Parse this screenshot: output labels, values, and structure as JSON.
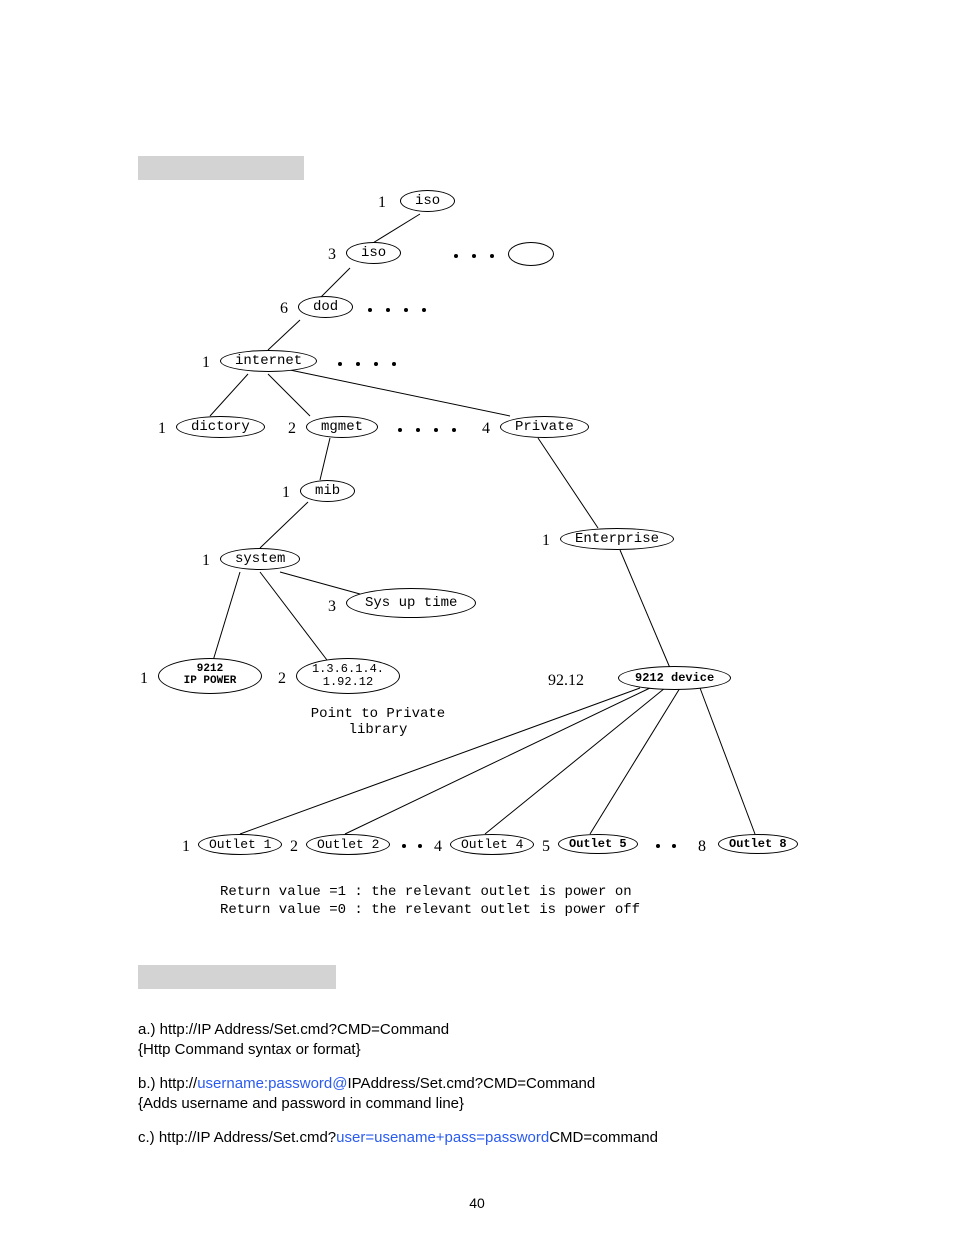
{
  "headers": {
    "section1": "",
    "section2": ""
  },
  "nodes": {
    "iso1": "iso",
    "iso2": "iso",
    "dod": "dod",
    "internet": "internet",
    "dictory": "dictory",
    "mgmet": "mgmet",
    "private": "Private",
    "mib": "mib",
    "enterprise": "Enterprise",
    "system": "system",
    "sysuptime": "Sys up time",
    "ippower": "9212\nIP POWER",
    "oid": "1.3.6.1.4.\n1.92.12",
    "device_id": "92.12",
    "device": "9212 device",
    "outlet1": "Outlet 1",
    "outlet2": "Outlet 2",
    "outlet4": "Outlet 4",
    "outlet5": "Outlet 5",
    "outlet8": "Outlet 8"
  },
  "nums": {
    "n1a": "1",
    "n3": "3",
    "n6": "6",
    "n1b": "1",
    "n1c": "1",
    "n2a": "2",
    "n4a": "4",
    "n1d": "1",
    "n1e": "1",
    "n1f": "1",
    "n3b": "3",
    "n1g": "1",
    "n2b": "2",
    "no1": "1",
    "no2": "2",
    "no4": "4",
    "no5": "5",
    "no8": "8"
  },
  "point_label": {
    "l1": "Point to Private",
    "l2": "library"
  },
  "legend": {
    "l1": "Return value =1 : the relevant outlet is power on",
    "l2": "Return value =0 : the relevant outlet is power off"
  },
  "body": {
    "a1": "a.) http://IP Address/Set.cmd?CMD=Command",
    "a2": "{Http Command syntax or format}",
    "b1_pre": "b.) http://",
    "b1_blue": "username:password@",
    "b1_post": "IPAddress/Set.cmd?CMD=Command",
    "b2": "{Adds username and password in command line}",
    "c1_pre": "c.) http://IP Address/Set.cmd?",
    "c1_blue": "user=usename+pass=password",
    "c1_post": "CMD=command"
  },
  "page_number": "40"
}
